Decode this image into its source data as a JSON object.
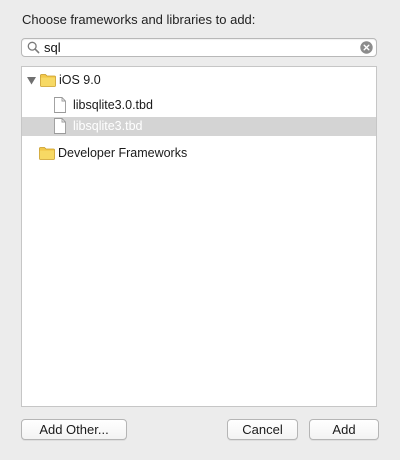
{
  "dialog": {
    "heading": "Choose frameworks and libraries to add:"
  },
  "search": {
    "value": "sql",
    "icon": "magnifier",
    "clear_icon": "clear-circle-x"
  },
  "tree": {
    "groups": [
      {
        "label": "iOS 9.0",
        "expanded": true,
        "icon": "folder",
        "items": [
          {
            "label": "libsqlite3.0.tbd",
            "icon": "document",
            "selected": false
          },
          {
            "label": "libsqlite3.tbd",
            "icon": "document",
            "selected": true
          }
        ]
      },
      {
        "label": "Developer Frameworks",
        "expanded": false,
        "icon": "folder",
        "items": []
      }
    ]
  },
  "buttons": {
    "add_other": "Add Other...",
    "cancel": "Cancel",
    "add": "Add"
  },
  "colors": {
    "window_bg": "#ececec",
    "selection": "#d4d4d4",
    "folder_fill": "#f2c84b"
  }
}
